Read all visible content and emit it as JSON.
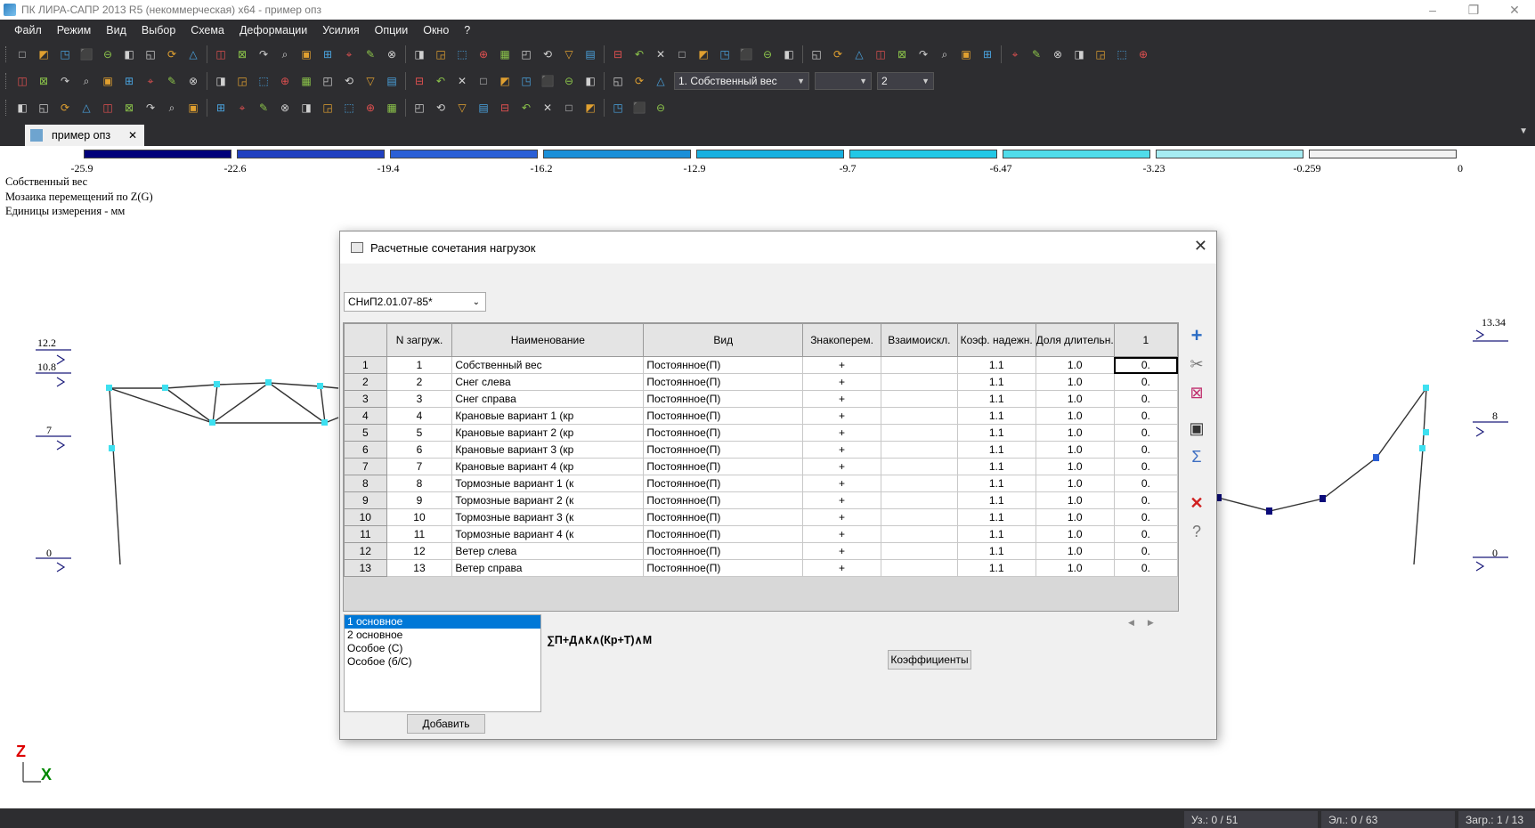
{
  "window": {
    "title": "ПК ЛИРА-САПР  2013 R5 (некоммерческая) x64 - пример опз",
    "controls": [
      "–",
      "❐",
      "✕"
    ]
  },
  "menu": [
    "Файл",
    "Режим",
    "Вид",
    "Выбор",
    "Схема",
    "Деформации",
    "Усилия",
    "Опции",
    "Окно",
    "?"
  ],
  "toolbar": {
    "load_case_combo": "1. Собственный вес",
    "empty_combo": "",
    "number_combo": "2"
  },
  "doc_tab": {
    "label": "пример опз",
    "close": "✕"
  },
  "scale": {
    "colors": [
      "#00007a",
      "#2040c0",
      "#2a5fd6",
      "#1a8fd8",
      "#17b0e0",
      "#22c8e6",
      "#50dcea",
      "#a6ecf2",
      "#f2f2f2"
    ],
    "labels": [
      "-25.9",
      "-22.6",
      "-19.4",
      "-16.2",
      "-12.9",
      "-9.7",
      "-6.47",
      "-3.23",
      "-0.259",
      "0"
    ]
  },
  "info": {
    "line1": "Собственный вес",
    "line2": "Мозаика перемещений по Z(G)",
    "line3": "Единицы измерения - мм"
  },
  "loads_left": [
    "12.2",
    "10.8",
    "7",
    "0"
  ],
  "loads_right": [
    "13.34",
    "8",
    "0"
  ],
  "axis": {
    "z": "Z",
    "x": "X"
  },
  "status": {
    "nodes": "Уз.: 0 / 51",
    "elements": "Эл.: 0 / 63",
    "loads": "Загр.: 1 / 13"
  },
  "dialog": {
    "title": "Расчетные сочетания нагрузок",
    "norm": "СНиП2.01.07-85*",
    "columns": [
      "N загруж.",
      "Наименование",
      "Вид",
      "Знакоперем.",
      "Взаимоискл.",
      "Коэф. надежн.",
      "Доля длительн.",
      "1"
    ],
    "rows": [
      {
        "n": "1",
        "num": "1",
        "name": "Собственный вес",
        "kind": "Постоянное(П)",
        "sign": "+",
        "excl": "",
        "coef": "1.1",
        "part": "1.0",
        "v": "0."
      },
      {
        "n": "2",
        "num": "2",
        "name": "Снег слева",
        "kind": "Постоянное(П)",
        "sign": "+",
        "excl": "",
        "coef": "1.1",
        "part": "1.0",
        "v": "0."
      },
      {
        "n": "3",
        "num": "3",
        "name": "Снег справа",
        "kind": "Постоянное(П)",
        "sign": "+",
        "excl": "",
        "coef": "1.1",
        "part": "1.0",
        "v": "0."
      },
      {
        "n": "4",
        "num": "4",
        "name": "Крановые вариант 1 (кр",
        "kind": "Постоянное(П)",
        "sign": "+",
        "excl": "",
        "coef": "1.1",
        "part": "1.0",
        "v": "0."
      },
      {
        "n": "5",
        "num": "5",
        "name": "Крановые вариант 2 (кр",
        "kind": "Постоянное(П)",
        "sign": "+",
        "excl": "",
        "coef": "1.1",
        "part": "1.0",
        "v": "0."
      },
      {
        "n": "6",
        "num": "6",
        "name": "Крановые вариант 3 (кр",
        "kind": "Постоянное(П)",
        "sign": "+",
        "excl": "",
        "coef": "1.1",
        "part": "1.0",
        "v": "0."
      },
      {
        "n": "7",
        "num": "7",
        "name": "Крановые вариант 4 (кр",
        "kind": "Постоянное(П)",
        "sign": "+",
        "excl": "",
        "coef": "1.1",
        "part": "1.0",
        "v": "0."
      },
      {
        "n": "8",
        "num": "8",
        "name": "Тормозные вариант 1 (к",
        "kind": "Постоянное(П)",
        "sign": "+",
        "excl": "",
        "coef": "1.1",
        "part": "1.0",
        "v": "0."
      },
      {
        "n": "9",
        "num": "9",
        "name": "Тормозные вариант 2 (к",
        "kind": "Постоянное(П)",
        "sign": "+",
        "excl": "",
        "coef": "1.1",
        "part": "1.0",
        "v": "0."
      },
      {
        "n": "10",
        "num": "10",
        "name": "Тормозные вариант 3 (к",
        "kind": "Постоянное(П)",
        "sign": "+",
        "excl": "",
        "coef": "1.1",
        "part": "1.0",
        "v": "0."
      },
      {
        "n": "11",
        "num": "11",
        "name": "Тормозные вариант 4 (к",
        "kind": "Постоянное(П)",
        "sign": "+",
        "excl": "",
        "coef": "1.1",
        "part": "1.0",
        "v": "0."
      },
      {
        "n": "12",
        "num": "12",
        "name": "Ветер слева",
        "kind": "Постоянное(П)",
        "sign": "+",
        "excl": "",
        "coef": "1.1",
        "part": "1.0",
        "v": "0."
      },
      {
        "n": "13",
        "num": "13",
        "name": "Ветер справа",
        "kind": "Постоянное(П)",
        "sign": "+",
        "excl": "",
        "coef": "1.1",
        "part": "1.0",
        "v": "0."
      }
    ],
    "combo_types": [
      "1 основное",
      "2 основное",
      "Особое (С)",
      "Особое (б/С)"
    ],
    "formula": "∑П+Д∧К∧(Кр+Т)∧М",
    "coef_button": "Коэффициенты",
    "add_button": "Добавить"
  }
}
